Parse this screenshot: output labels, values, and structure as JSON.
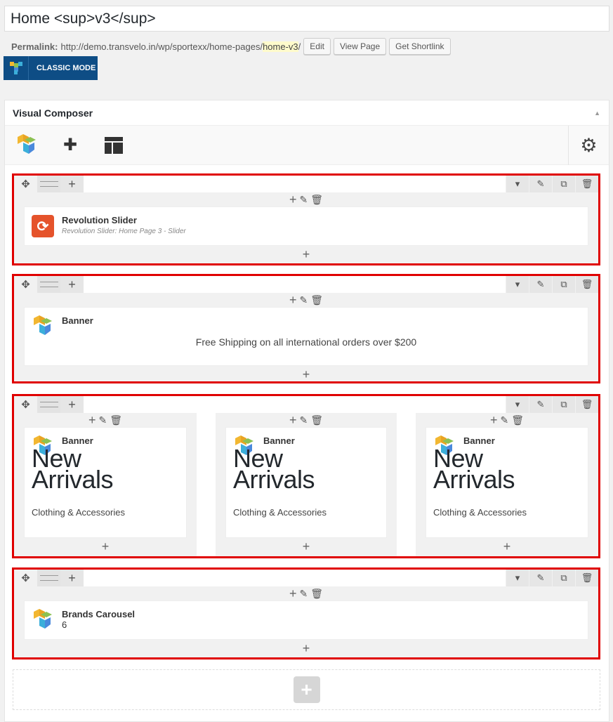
{
  "post": {
    "title": "Home <sup>v3</sup>",
    "permalink_label": "Permalink:",
    "permalink_base": "http://demo.transvelo.in/wp/sportexx/home-pages/",
    "permalink_slug": "home-v3",
    "permalink_trail": "/",
    "edit_label": "Edit",
    "view_label": "View Page",
    "shortlink_label": "Get Shortlink"
  },
  "classic_mode_label": "CLASSIC MODE",
  "panel": {
    "title": "Visual Composer",
    "collapse_glyph": "▲"
  },
  "toolbar": {
    "add_glyph": "✚",
    "templates_glyph": "▦",
    "settings_glyph": "⚙"
  },
  "row_controls": {
    "move_glyph": "✥",
    "add_glyph": "+",
    "toggle_glyph": "▾",
    "edit_glyph": "✎",
    "clone_glyph": "⧉",
    "delete_glyph": "🗑"
  },
  "rows": [
    {
      "element": {
        "title": "Revolution Slider",
        "subtitle": "Revolution Slider: Home Page 3 - Slider",
        "icon": "revolution-slider-icon"
      }
    },
    {
      "element": {
        "title": "Banner",
        "text": "Free Shipping on all international orders over $200",
        "icon": "vc-logo-icon"
      }
    },
    {
      "columns": [
        {
          "title": "Banner",
          "heading_line1": "New",
          "heading_line2": "Arrivals",
          "subtitle": "Clothing & Accessories"
        },
        {
          "title": "Banner",
          "heading_line1": "New",
          "heading_line2": "Arrivals",
          "subtitle": "Clothing & Accessories"
        },
        {
          "title": "Banner",
          "heading_line1": "New",
          "heading_line2": "Arrivals",
          "subtitle": "Clothing & Accessories"
        }
      ]
    },
    {
      "element": {
        "title": "Brands Carousel",
        "value": "6",
        "icon": "vc-logo-icon"
      }
    }
  ],
  "add_element_glyph": "+",
  "colors": {
    "highlight_border": "#e00000",
    "classic_button": "#0e4d85",
    "revslider_icon": "#e5532b"
  }
}
